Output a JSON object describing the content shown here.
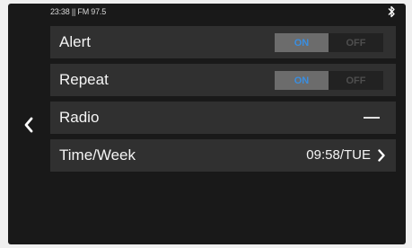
{
  "status": {
    "text": "23:38 || FM 97.5",
    "bluetooth_icon": "bluetooth-icon"
  },
  "navigation": {
    "back_icon": "chevron-left-icon"
  },
  "settings": [
    {
      "label": "Alert",
      "on_label": "ON",
      "off_label": "OFF",
      "state": "on"
    },
    {
      "label": "Repeat",
      "on_label": "ON",
      "off_label": "OFF",
      "state": "on"
    },
    {
      "label": "Radio",
      "value": "—"
    },
    {
      "label": "Time/Week",
      "value": "09:58/TUE",
      "chevron_icon": "chevron-right-icon"
    }
  ],
  "colors": {
    "background": "#191919",
    "row": "#303030",
    "toggle_on_fill": "#6c6c6c",
    "toggle_on_text": "#3a8ee0",
    "toggle_off_text": "#4e4e4e"
  }
}
